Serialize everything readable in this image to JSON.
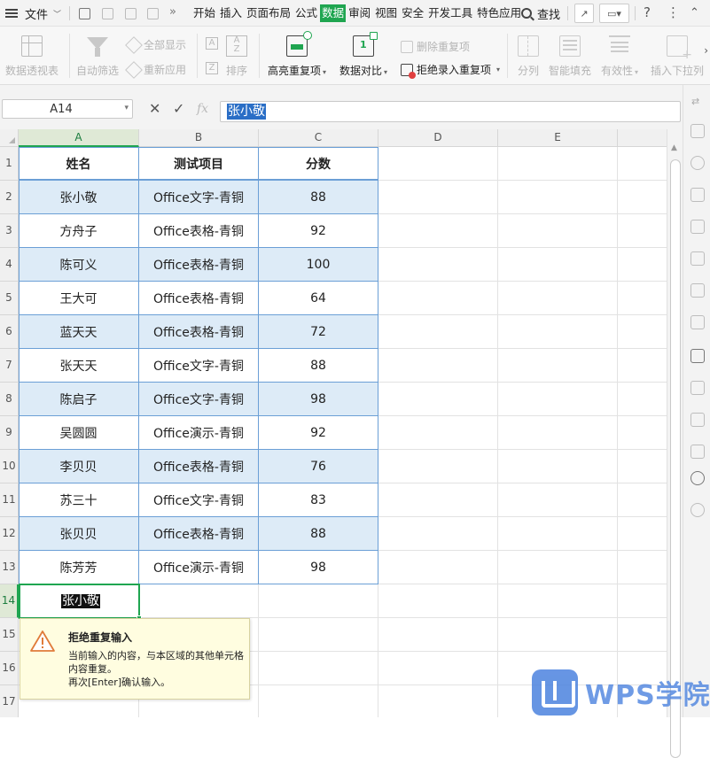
{
  "menubar": {
    "file_label": "文件",
    "tabs": [
      "开始",
      "插入",
      "页面布局",
      "公式",
      "数据",
      "审阅",
      "视图",
      "安全",
      "开发工具",
      "特色应用"
    ],
    "active_tab": "数据",
    "find_label": "查找",
    "more_symbol": "»",
    "help_symbol": "?",
    "more_menu_symbol": "⋮",
    "close_symbol": "✕"
  },
  "ribbon": {
    "pivot_label": "数据透视表",
    "autofilter_label": "自动筛选",
    "show_all_label": "全部显示",
    "reapply_label": "重新应用",
    "sort_label": "排序",
    "highlight_dup_label": "高亮重复项",
    "compare_label": "数据对比",
    "delete_dup_label": "删除重复项",
    "reject_dup_label": "拒绝录入重复项",
    "split_label": "分列",
    "smart_fill_label": "智能填充",
    "validity_label": "有效性",
    "insert_dropdown_label": "插入下拉列"
  },
  "formula_bar": {
    "cell_ref": "A14",
    "cancel_symbol": "✕",
    "confirm_symbol": "✓",
    "fx_label": "fx",
    "value": "张小敬"
  },
  "grid": {
    "columns": [
      "A",
      "B",
      "C",
      "D",
      "E"
    ],
    "rows": [
      "1",
      "2",
      "3",
      "4",
      "5",
      "6",
      "7",
      "8",
      "9",
      "10",
      "11",
      "12",
      "13",
      "14",
      "15",
      "16",
      "17"
    ],
    "headers": [
      "姓名",
      "测试项目",
      "分数"
    ],
    "data": [
      [
        "张小敬",
        "Office文字-青铜",
        "88"
      ],
      [
        "方舟子",
        "Office表格-青铜",
        "92"
      ],
      [
        "陈可义",
        "Office表格-青铜",
        "100"
      ],
      [
        "王大可",
        "Office表格-青铜",
        "64"
      ],
      [
        "蓝天天",
        "Office表格-青铜",
        "72"
      ],
      [
        "张天天",
        "Office文字-青铜",
        "88"
      ],
      [
        "陈启子",
        "Office文字-青铜",
        "98"
      ],
      [
        "吴圆圆",
        "Office演示-青铜",
        "92"
      ],
      [
        "李贝贝",
        "Office表格-青铜",
        "76"
      ],
      [
        "苏三十",
        "Office文字-青铜",
        "83"
      ],
      [
        "张贝贝",
        "Office表格-青铜",
        "88"
      ],
      [
        "陈芳芳",
        "Office演示-青铜",
        "98"
      ]
    ],
    "editing_value": "张小敬"
  },
  "warning": {
    "title": "拒绝重复输入",
    "line1": "当前输入的内容，与本区域的其他单元格内容重复。",
    "line2": "再次[Enter]确认输入。"
  },
  "watermark": {
    "text": "WPS学院"
  },
  "colors": {
    "accent": "#1fa550",
    "table_border": "#6b9fd6",
    "band_fill": "#ddebf7",
    "warning_bg": "#fffde0",
    "wps_blue": "#4c83df"
  }
}
